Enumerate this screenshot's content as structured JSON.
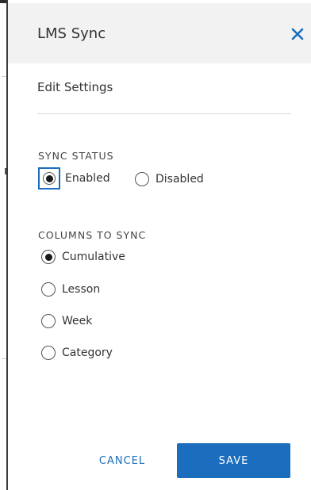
{
  "panel": {
    "title": "LMS Sync",
    "subtitle": "Edit Settings",
    "close_icon": "close-icon"
  },
  "sync_status": {
    "label": "SYNC STATUS",
    "options": [
      {
        "label": "Enabled",
        "selected": true
      },
      {
        "label": "Disabled",
        "selected": false
      }
    ]
  },
  "columns": {
    "label": "COLUMNS TO SYNC",
    "options": [
      {
        "label": "Cumulative",
        "selected": true
      },
      {
        "label": "Lesson",
        "selected": false
      },
      {
        "label": "Week",
        "selected": false
      },
      {
        "label": "Category",
        "selected": false
      }
    ]
  },
  "actions": {
    "cancel_label": "CANCEL",
    "save_label": "SAVE"
  },
  "colors": {
    "accent": "#1a6ebd",
    "header_bg": "#f2f2f2"
  }
}
